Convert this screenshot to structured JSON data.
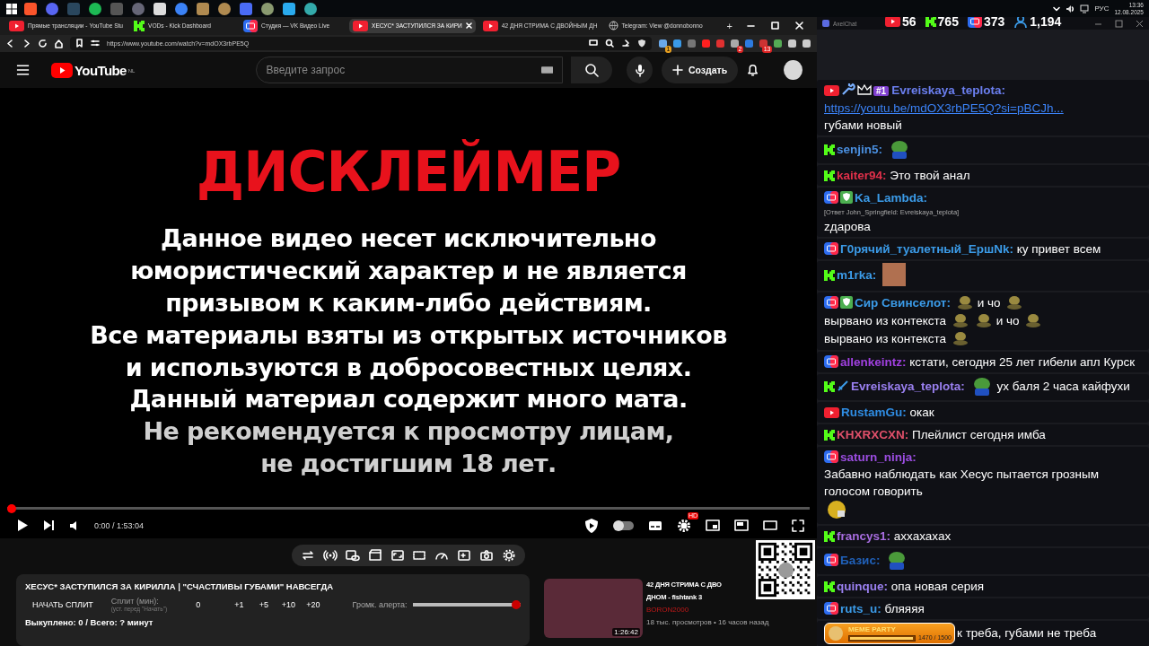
{
  "taskbar": {
    "language": "РУС",
    "time": "13:36",
    "date": "12.08.2025"
  },
  "browser": {
    "tabs": [
      {
        "kind": "youtube",
        "title": "Прямые трансляции - YouTube Stu",
        "selected": false
      },
      {
        "kind": "kick",
        "title": "VODs - Kick Dashboard",
        "selected": false
      },
      {
        "kind": "vk",
        "title": "Студия — VK Видео Live",
        "selected": false
      },
      {
        "kind": "youtube",
        "title": "ХЕСУС* ЗАСТУПИЛСЯ ЗА КИРИ",
        "selected": true
      },
      {
        "kind": "youtube",
        "title": "42 ДНЯ СТРИМА С ДВОЙНЫМ ДН",
        "selected": false
      },
      {
        "kind": "globe",
        "title": "Telegram: View @donnobonno",
        "selected": false
      }
    ],
    "new_tab": "+",
    "address": "https://www.youtube.com/watch?v=mdOX3rbPE5Q",
    "extensions": [
      {
        "color": "#6aa8e8",
        "badge": "1"
      },
      {
        "color": "#3a9ae8"
      },
      {
        "color": "#777777"
      },
      {
        "color": "#ff2020"
      },
      {
        "color": "#e03030"
      },
      {
        "color": "#aaaaaa",
        "badge": "2"
      },
      {
        "color": "#2d7be0"
      },
      {
        "color": "#cc3333",
        "badge": "13"
      },
      {
        "color": "#55aa55"
      },
      {
        "color": "#cccccc"
      },
      {
        "color": "#cccccc"
      }
    ]
  },
  "youtube": {
    "logo": "YouTube",
    "region": "NL",
    "search_placeholder": "Введите запрос",
    "create_label": "Создать"
  },
  "video": {
    "heading": "ДИСКЛЕЙМЕР",
    "lines": [
      {
        "text": "Данное видео несет исключительно",
        "dimmed": false
      },
      {
        "text": "юмористический характер и не является",
        "dimmed": false
      },
      {
        "text": "призывом к каким-либо действиям.",
        "dimmed": false
      },
      {
        "text": "Все материалы взяты из открытых источников",
        "dimmed": false
      },
      {
        "text": "и используются в добросовестных целях.",
        "dimmed": false
      },
      {
        "text": "Данный материал содержит много мата.",
        "dimmed": false
      },
      {
        "text": "Не рекомендуется к просмотру лицам,",
        "dimmed": true
      },
      {
        "text": "не достигшим 18 лет.",
        "dimmed": true
      }
    ],
    "progress": {
      "level": 0
    },
    "time": "0:00 / 1:53:04",
    "autoplay": false,
    "quality_badge": "HD"
  },
  "split_panel": {
    "title": "ХЕСУС* ЗАСТУПИЛСЯ ЗА КИРИЛЛА | \"СЧАСТЛИВЫ ГУБАМИ\" НАВСЕГДА",
    "start_button": "НАЧАТЬ СПЛИТ",
    "split_label": "Сплит (мин):",
    "split_hint": "(уст. перед \"Начать\")",
    "split_value": "0",
    "increments": [
      "+1",
      "+5",
      "+10",
      "+20"
    ],
    "alert_label": "Громк. алерта:",
    "alert_volume": {
      "level": 1
    },
    "summary": "Выкуплено: 0 / Всего: ? минут"
  },
  "recommended": {
    "title_line_1": "42 ДНЯ СТРИМА С ДВО",
    "title_line_2": "ДНОМ - fishtank 3",
    "channel": "BORON2000",
    "meta": "18 тыс. просмотров • 16 часов назад",
    "duration": "1:26:42"
  },
  "chat": {
    "title": "AxelChat",
    "stats": [
      {
        "kind": "youtube",
        "count": "56"
      },
      {
        "kind": "kick",
        "count": "765"
      },
      {
        "kind": "vk",
        "count": "373"
      },
      {
        "kind": "viewers",
        "count": "1,194"
      }
    ],
    "messages": [
      {
        "kind": "youtube",
        "badges": [
          {
            "kind": "wrench"
          },
          {
            "kind": "crown"
          },
          {
            "kind": "rank",
            "text": "#1"
          }
        ],
        "author": "Evreiskaya_teplota:",
        "color": "#6b7ff0",
        "parts": [
          {
            "kind": "link",
            "text": "https://youtu.be/mdOX3rbPE5Q?si=pBCJh..."
          },
          {
            "kind": "text",
            "text": "губами новый"
          }
        ]
      },
      {
        "kind": "kick",
        "author": "senjin5:",
        "color": "#4a8fe0",
        "parts": [
          {
            "kind": "frog"
          }
        ]
      },
      {
        "kind": "kick",
        "author": "kaiter94:",
        "color": "#e0304a",
        "parts": [
          {
            "kind": "text",
            "text": "Это твой анал"
          }
        ]
      },
      {
        "kind": "vk",
        "badges": [
          {
            "kind": "moderator"
          }
        ],
        "author": "Ka_Lambda:",
        "color": "#3b9be8",
        "reply": "[Ответ John_Springfield: Evreiskaya_teplota]",
        "parts": [
          {
            "kind": "text",
            "text": "zдарова"
          }
        ]
      },
      {
        "kind": "vk",
        "author": "Г0рячий_туалетный_ЕршNk:",
        "color": "#3b9be8",
        "parts": [
          {
            "kind": "text",
            "text": "ку привет всем"
          }
        ]
      },
      {
        "kind": "kick",
        "author": "m1rka:",
        "color": "#3b9be8",
        "parts": [
          {
            "kind": "photo"
          }
        ]
      },
      {
        "kind": "vk",
        "badges": [
          {
            "kind": "moderator"
          }
        ],
        "author": "Сир Свинселот:",
        "color": "#3b9be8",
        "parts": [
          {
            "kind": "blob"
          },
          {
            "kind": "text",
            "text": "и чо"
          },
          {
            "kind": "blob"
          },
          {
            "kind": "text",
            "text": "вырвано из контекста"
          },
          {
            "kind": "blob"
          },
          {
            "kind": "blob"
          },
          {
            "kind": "text",
            "text": "и чо"
          },
          {
            "kind": "blob"
          },
          {
            "kind": "text",
            "text": "вырвано из контекста"
          },
          {
            "kind": "blob"
          }
        ]
      },
      {
        "kind": "vk",
        "author": "allenkeintz:",
        "color": "#a040e0",
        "parts": [
          {
            "kind": "text",
            "text": "кстати, сегодня 25 лет гибели апл Курск"
          }
        ]
      },
      {
        "kind": "kick",
        "badges": [
          {
            "kind": "sword"
          }
        ],
        "author": "Evreiskaya_teplota:",
        "color": "#9a80f0",
        "parts": [
          {
            "kind": "frog"
          },
          {
            "kind": "text",
            "text": "ух баля 2 часа кайфухи"
          }
        ]
      },
      {
        "kind": "youtube",
        "author": "RustamGu:",
        "color": "#2f8de4",
        "parts": [
          {
            "kind": "text",
            "text": "окак"
          }
        ]
      },
      {
        "kind": "kick",
        "author": "KHXRXCXN:",
        "color": "#e0506a",
        "parts": [
          {
            "kind": "text",
            "text": "Плейлист сегодня имба"
          }
        ]
      },
      {
        "kind": "vk",
        "author": "saturn_ninja:",
        "color": "#9b4de0",
        "parts": [
          {
            "kind": "text",
            "text": "Забавно наблюдать как Хесус пытается грозным голосом говорить"
          },
          {
            "kind": "smiley"
          }
        ]
      },
      {
        "kind": "kick",
        "author": "francys1:",
        "color": "#a86de0",
        "parts": [
          {
            "kind": "text",
            "text": "аххахахах"
          }
        ]
      },
      {
        "kind": "vk",
        "author": "Базис:",
        "color": "#2060b8",
        "parts": [
          {
            "kind": "frog"
          }
        ]
      },
      {
        "kind": "kick",
        "author": "quinque:",
        "color": "#9a80f0",
        "parts": [
          {
            "kind": "text",
            "text": "опа новая серия"
          }
        ]
      },
      {
        "kind": "vk",
        "author": "ruts_u:",
        "color": "#3b9be8",
        "parts": [
          {
            "kind": "text",
            "text": "бляяяя"
          }
        ]
      },
      {
        "kind": "banner",
        "banner": {
          "title": "MEME PARTY",
          "progress": "1470 / 1500",
          "level": 0.98
        },
        "parts": [
          {
            "kind": "text",
            "text": "к треба, губами не треба"
          }
        ]
      }
    ]
  }
}
